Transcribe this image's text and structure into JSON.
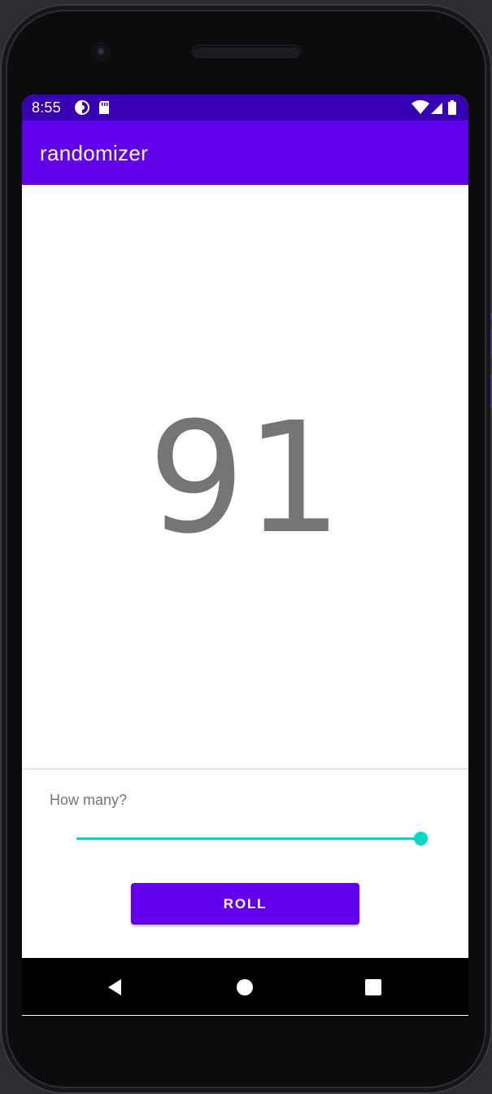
{
  "status_bar": {
    "time": "8:55",
    "left_icons": [
      "data-saver-icon",
      "sd-card-icon"
    ],
    "right_icons": [
      "wifi-icon",
      "signal-icon",
      "battery-icon"
    ]
  },
  "app_bar": {
    "title": "randomizer",
    "color": "#6200ee"
  },
  "main": {
    "result": "91"
  },
  "controls": {
    "slider_label": "How many?",
    "slider_value_fraction": 1.0,
    "slider_color": "#03dac5",
    "roll_label": "ROLL",
    "roll_color": "#6200ee"
  },
  "nav_bar": {
    "items": [
      "back-icon",
      "home-icon",
      "recents-icon"
    ]
  }
}
